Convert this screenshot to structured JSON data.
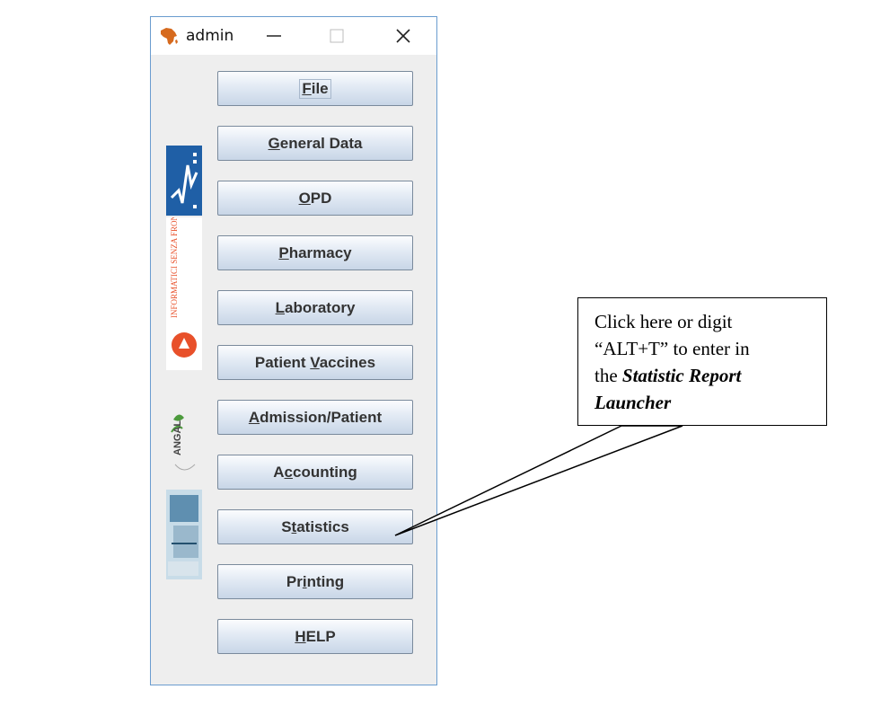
{
  "window": {
    "title": "admin",
    "icon": "africa-map-icon",
    "controls": [
      "minimize-icon",
      "maximize-icon",
      "close-icon"
    ]
  },
  "menu": {
    "buttons": [
      {
        "pre": "",
        "u": "F",
        "post": "ile"
      },
      {
        "pre": "",
        "u": "G",
        "post": "eneral Data"
      },
      {
        "pre": "",
        "u": "O",
        "post": "PD"
      },
      {
        "pre": "",
        "u": "P",
        "post": "harmacy"
      },
      {
        "pre": "",
        "u": "L",
        "post": "aboratory"
      },
      {
        "pre": "Patient ",
        "u": "V",
        "post": "accines"
      },
      {
        "pre": "",
        "u": "A",
        "post": "dmission/Patient"
      },
      {
        "pre": "A",
        "u": "c",
        "post": "counting"
      },
      {
        "pre": "S",
        "u": "t",
        "post": "atistics"
      },
      {
        "pre": "Pr",
        "u": "i",
        "post": "nting"
      },
      {
        "pre": "",
        "u": "H",
        "post": "ELP"
      }
    ]
  },
  "logos": {
    "isf": "INFORMATICI SENZA FRONTIERE",
    "angal": "ANGAL"
  },
  "callout": {
    "line1": "Click here or digit",
    "line2": "“ALT+T” to enter in",
    "line3_pre": "the ",
    "line3_bold": "Statistic Report",
    "line4_bold": "Launcher"
  },
  "colors": {
    "window_border": "#6a9ccf",
    "button_border": "#7a8a9c",
    "isf_red": "#e8502a",
    "logo_blue": "#1f5fa6"
  }
}
